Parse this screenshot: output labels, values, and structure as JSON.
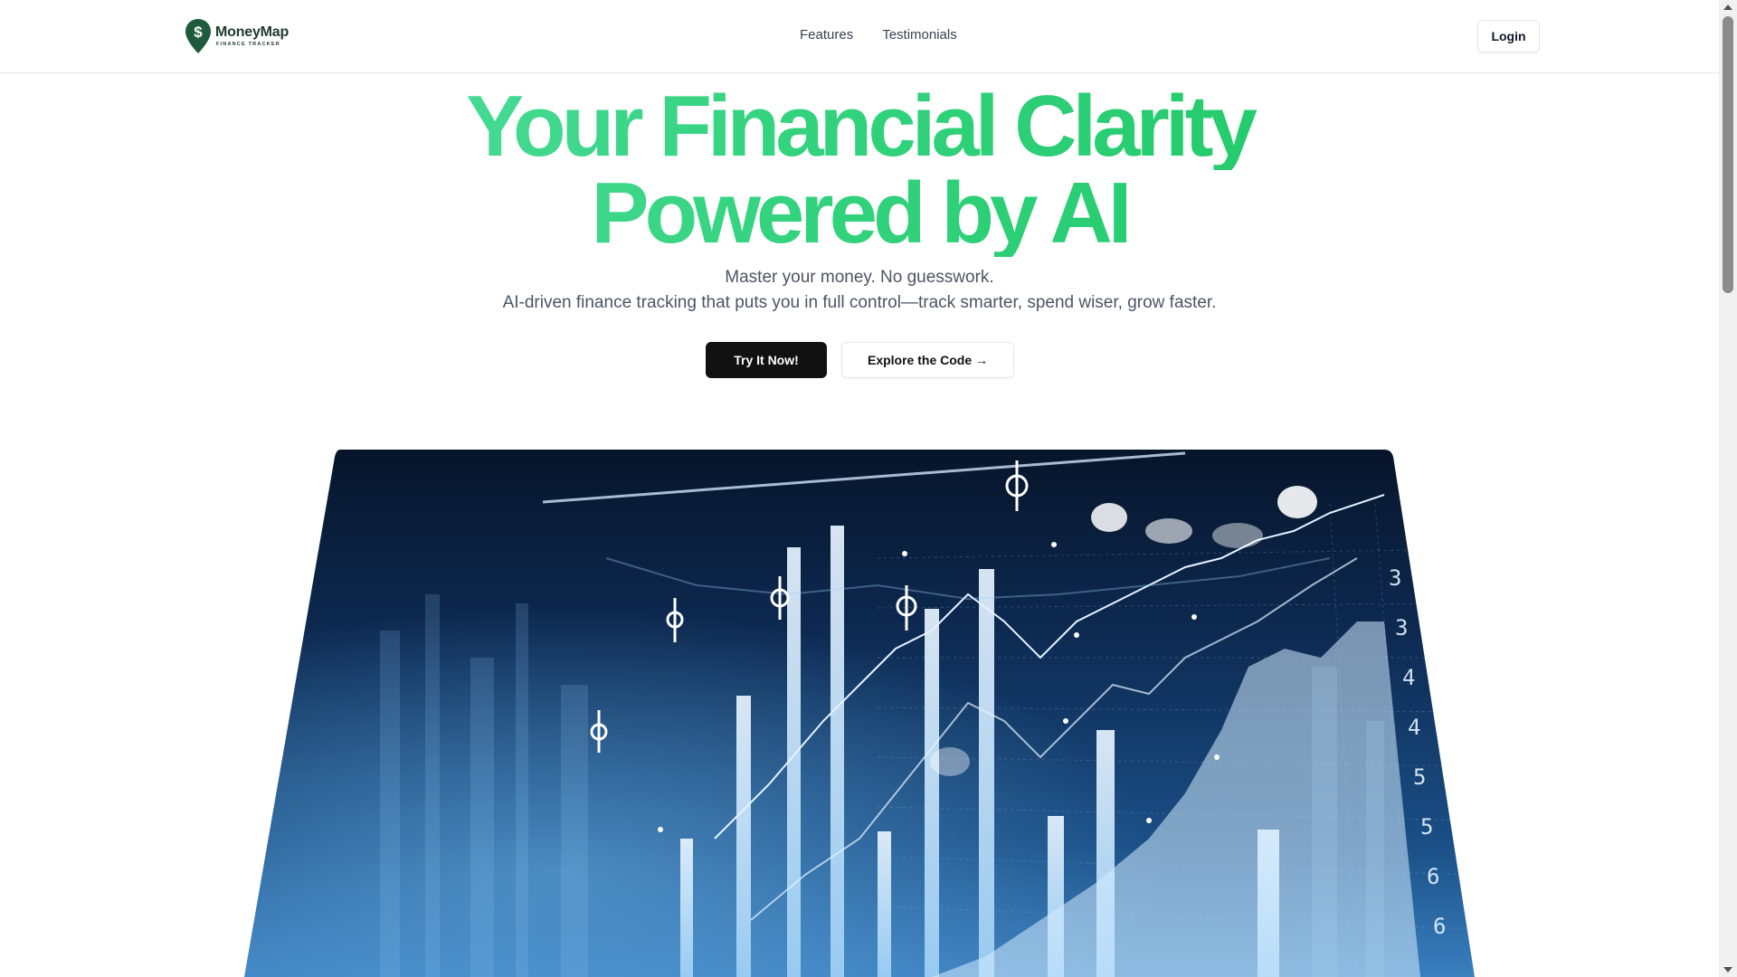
{
  "header": {
    "brand_name": "MoneyMap",
    "brand_tagline": "FINANCE TRACKER",
    "brand_color": "#1f3b2d",
    "nav": [
      {
        "label": "Features"
      },
      {
        "label": "Testimonials"
      }
    ],
    "login_label": "Login"
  },
  "hero": {
    "title_line1": "Your Financial Clarity",
    "title_line2": "Powered by AI",
    "gradient_colors": [
      "#5ee4b0",
      "#34d37f",
      "#16c35a"
    ],
    "subtitle_line1": "Master your money. No guesswork.",
    "subtitle_line2": "AI-driven finance tracking that puts you in full control—track smarter, spend wiser, grow faster.",
    "primary_cta": "Try It Now!",
    "secondary_cta": "Explore the Code →",
    "image_axis_labels": [
      "3",
      "3",
      "4",
      "4",
      "5",
      "5",
      "6",
      "6"
    ]
  },
  "icons": {
    "logo": "dollar-pin-icon",
    "scroll_up": "triangle-up-icon",
    "scroll_down": "triangle-down-icon"
  }
}
